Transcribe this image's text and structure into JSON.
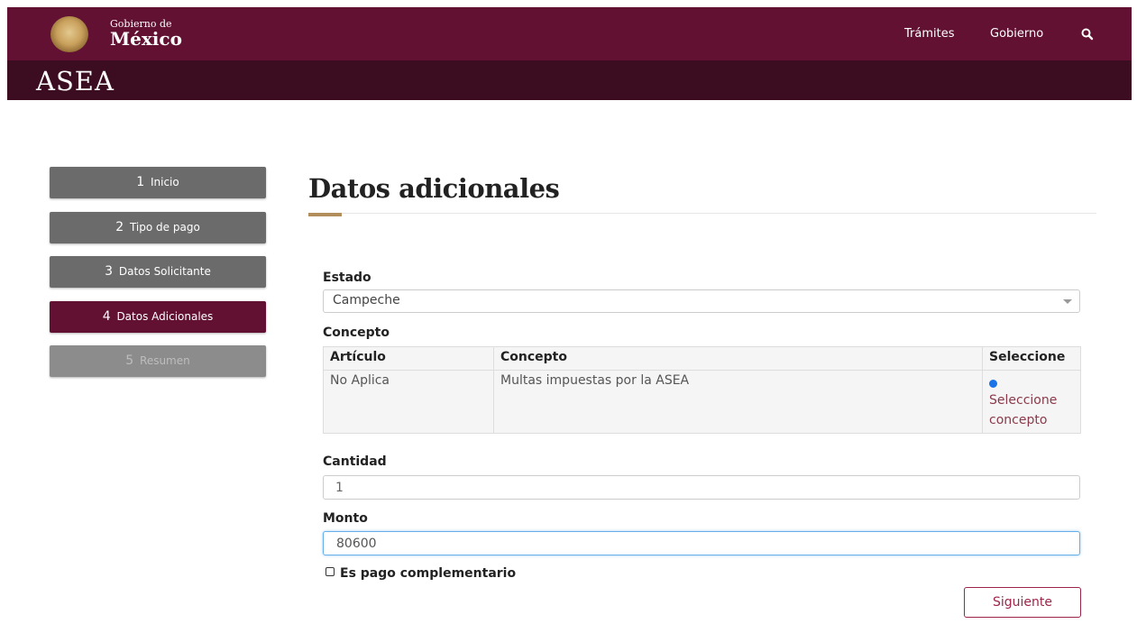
{
  "header": {
    "logo_line1": "Gobierno de",
    "logo_line2": "México",
    "nav": [
      {
        "label": "Trámites"
      },
      {
        "label": "Gobierno"
      }
    ],
    "search_icon": "search-icon",
    "agency": "ASEA",
    "primary_color": "#621132",
    "secondary_color": "#3c0d20"
  },
  "steps": [
    {
      "num": "1",
      "label": "Inicio",
      "state": "done"
    },
    {
      "num": "2",
      "label": "Tipo de pago",
      "state": "done"
    },
    {
      "num": "3",
      "label": "Datos Solicitante",
      "state": "done"
    },
    {
      "num": "4",
      "label": "Datos Adicionales",
      "state": "active"
    },
    {
      "num": "5",
      "label": "Resumen",
      "state": "disabled"
    }
  ],
  "main": {
    "title": "Datos adicionales",
    "estado_label": "Estado",
    "estado_value": "Campeche",
    "concepto_label": "Concepto",
    "table": {
      "headers": [
        "Artículo",
        "Concepto",
        "Seleccione"
      ],
      "rows": [
        {
          "articulo": "No Aplica",
          "concepto": "Multas impuestas por la ASEA",
          "action": "Seleccione concepto",
          "selected": true
        }
      ]
    },
    "cantidad_label": "Cantidad",
    "cantidad_value": "1",
    "monto_label": "Monto",
    "monto_value": "80600",
    "checkbox_label": "Es pago complementario",
    "checkbox_checked": false,
    "next_button": "Siguiente"
  }
}
